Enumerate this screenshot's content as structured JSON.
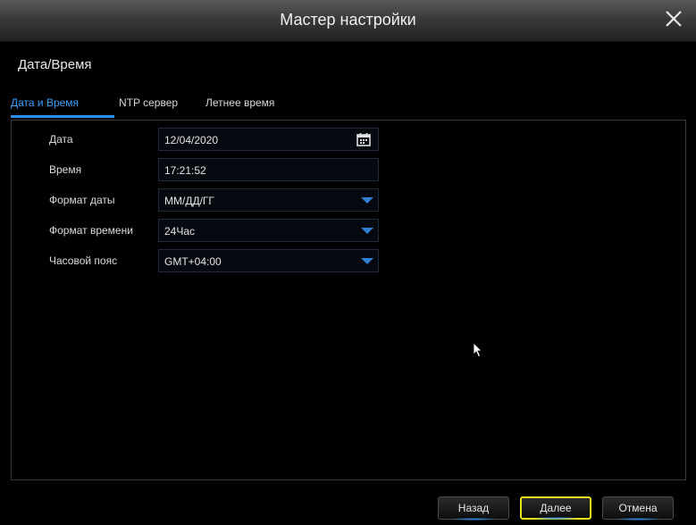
{
  "window": {
    "title": "Мастер настройки",
    "close_icon": "close-icon"
  },
  "section": {
    "title": "Дата/Время"
  },
  "tabs": [
    {
      "label": "Дата и Время",
      "active": true
    },
    {
      "label": "NTP сервер",
      "active": false
    },
    {
      "label": "Летнее время",
      "active": false
    }
  ],
  "form": {
    "date": {
      "label": "Дата",
      "value": "12/04/2020",
      "icon": "calendar-icon"
    },
    "time": {
      "label": "Время",
      "value": "17:21:52"
    },
    "date_format": {
      "label": "Формат даты",
      "value": "ММ/ДД/ГГ"
    },
    "time_format": {
      "label": "Формат времени",
      "value": "24Час"
    },
    "timezone": {
      "label": "Часовой пояс",
      "value": "GMT+04:00"
    }
  },
  "buttons": {
    "back": "Назад",
    "next": "Далее",
    "cancel": "Отмена"
  },
  "colors": {
    "accent": "#2f8fe8",
    "active_tab": "#3da0ff",
    "focus": "#e7e21a"
  }
}
